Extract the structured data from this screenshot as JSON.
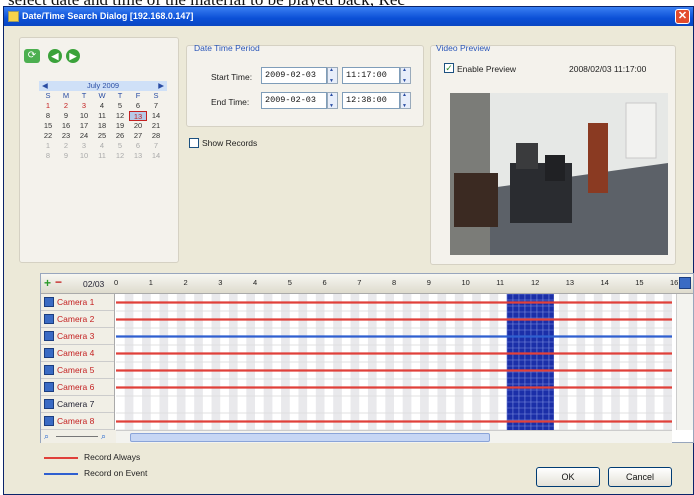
{
  "caption_text": "select date and time of the material to be played back; Rec",
  "window": {
    "title": "Date/Time Search Dialog [192.168.0.147]",
    "close": "✕"
  },
  "calendar": {
    "month_label": "July 2009",
    "prev": "◀",
    "next": "▶",
    "day_names": [
      "S",
      "M",
      "T",
      "W",
      "T",
      "F",
      "S"
    ],
    "weeks": [
      [
        "1",
        "2",
        "3",
        "4",
        "5",
        "6",
        "7"
      ],
      [
        "8",
        "9",
        "10",
        "11",
        "12",
        "13",
        "14"
      ],
      [
        "15",
        "16",
        "17",
        "18",
        "19",
        "20",
        "21"
      ],
      [
        "22",
        "23",
        "24",
        "25",
        "26",
        "27",
        "28"
      ],
      [
        "1",
        "2",
        "3",
        "4",
        "5",
        "6",
        "7"
      ],
      [
        "8",
        "9",
        "10",
        "11",
        "12",
        "13",
        "14"
      ]
    ]
  },
  "date_time": {
    "group_label": "Date Time Period",
    "start_label": "Start Time:",
    "start_date": "2009-02-03",
    "start_time": "11:17:00",
    "end_label": "End Time:",
    "end_date": "2009-02-03",
    "end_time": "12:38:00"
  },
  "show_records": {
    "label": "Show Records",
    "checked": false
  },
  "video_preview": {
    "group_label": "Video Preview",
    "enable_label": "Enable Preview",
    "enable_checked": true,
    "timestamp": "2008/02/03 11:17:00"
  },
  "timeline": {
    "page": "02/03",
    "hours": [
      "0",
      "1",
      "2",
      "3",
      "4",
      "5",
      "6",
      "7",
      "8",
      "9",
      "10",
      "11",
      "12",
      "13",
      "14",
      "15",
      "16"
    ],
    "cameras": [
      {
        "name": "Camera 1",
        "record": "always"
      },
      {
        "name": "Camera 2",
        "record": "always"
      },
      {
        "name": "Camera 3",
        "record": "event"
      },
      {
        "name": "Camera 4",
        "record": "always"
      },
      {
        "name": "Camera 5",
        "record": "always"
      },
      {
        "name": "Camera 6",
        "record": "always"
      },
      {
        "name": "Camera 7",
        "record": "none"
      },
      {
        "name": "Camera 8",
        "record": "always"
      }
    ],
    "selection_hour_start": 11.25,
    "selection_hour_end": 12.6
  },
  "legend": {
    "always_label": "Record Always",
    "event_label": "Record on Event",
    "always_color": "#e0403a",
    "event_color": "#2f5fd0"
  },
  "buttons": {
    "ok": "OK",
    "cancel": "Cancel"
  },
  "icons": [
    "refresh-icon",
    "back-icon",
    "forward-icon",
    "add-icon",
    "remove-icon",
    "zoom-out-icon",
    "zoom-in-icon"
  ]
}
